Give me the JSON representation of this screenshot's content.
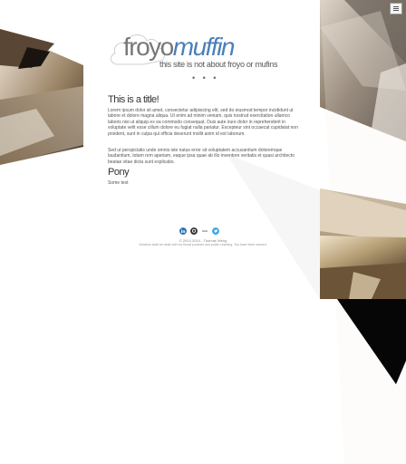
{
  "header": {
    "menu_icon": "hamburger-menu-icon",
    "logo": {
      "froyo": "froyo",
      "muffin": "muffin",
      "muffin_color": "#4b7fb8",
      "tagline": "this site is not about froyo or mufins"
    },
    "ellipsis": "• • •"
  },
  "main": {
    "title": "This is a title!",
    "paragraphs": [
      "Lorem ipsum dolor sit amet, consectetur adipisicing elit, sed do eiusmod tempor incididunt ut labore et dolore magna aliqua. Ut enim ad minim veniam, quis nostrud exercitation ullamco laboris nisi ut aliquip ex ea commodo consequat. Duis aute irure dolor in reprehenderit in voluptate velit esse cillum dolore eu fugiat nulla pariatur. Excepteur sint occaecat cupidatat non proident, sunt in culpa qui officia deserunt mollit anim id est laborum.",
      "Sed ut perspiciatis unde omnis iste natus error sit voluptatem accusantium doloremque laudantium, totam rem aperiam, eaque ipsa quae ab illo inventore veritatis et quasi architecto beatae vitae dicta sunt explicabo."
    ],
    "subtitle": "Pony",
    "some_text": "Some text"
  },
  "footer": {
    "social": [
      {
        "icon": "linkedin-icon",
        "color": "#2a6fb0"
      },
      {
        "icon": "github-icon",
        "color": "#333333"
      },
      {
        "icon": "more-icon",
        "color": "#666666"
      },
      {
        "icon": "twitter-icon",
        "color": "#3aa6e0"
      }
    ],
    "copyright": "© 2013-2014 - Thomas Weng",
    "disclaimer": "Violators shall be dealt with via throat punches and public shaming. You have been warned."
  }
}
